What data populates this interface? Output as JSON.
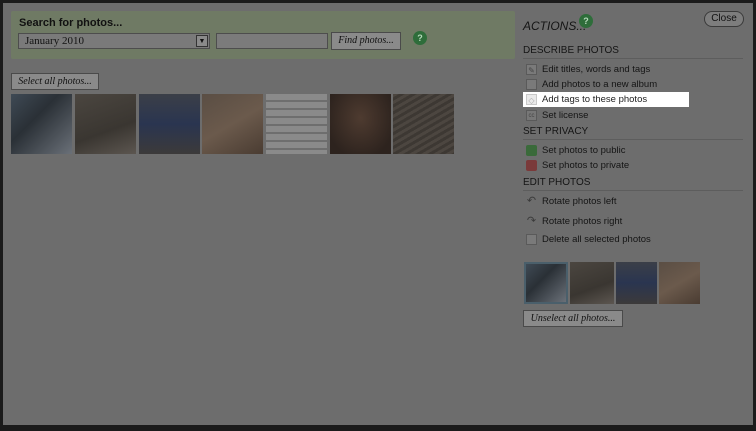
{
  "search": {
    "title": "Search for photos...",
    "month_value": "January 2010",
    "query_value": "",
    "find_label": "Find photos...",
    "help_icon": "question-bubble-icon"
  },
  "photos": {
    "select_all_label": "Select all photos...",
    "count": 7
  },
  "panel": {
    "actions_title": "ACTIONS...",
    "close_label": "Close",
    "sections": {
      "describe": {
        "header": "DESCRIBE PHOTOS",
        "items": [
          {
            "label": "Edit titles, words and tags",
            "icon": "pencil-icon"
          },
          {
            "label": "Add photos to a new album",
            "icon": "album-icon"
          },
          {
            "label": "Add tags to these photos",
            "icon": "tag-icon"
          },
          {
            "label": "Set license",
            "icon": "cc-license-icon"
          }
        ]
      },
      "privacy": {
        "header": "SET PRIVACY",
        "items": [
          {
            "label": "Set photos to public",
            "icon": "unlocked-icon"
          },
          {
            "label": "Set photos to private",
            "icon": "locked-icon"
          }
        ]
      },
      "edit": {
        "header": "EDIT PHOTOS",
        "items": [
          {
            "label": "Rotate photos left",
            "icon": "rotate-left-icon"
          },
          {
            "label": "Rotate photos right",
            "icon": "rotate-right-icon"
          },
          {
            "label": "Delete all selected photos",
            "icon": "trash-icon"
          }
        ]
      }
    },
    "selected_count": 4,
    "unselect_label": "Unselect all photos..."
  },
  "colors": {
    "highlight": "#ffffff",
    "search_box": "#6f7a64",
    "help_icon": "#2e6d3a"
  }
}
